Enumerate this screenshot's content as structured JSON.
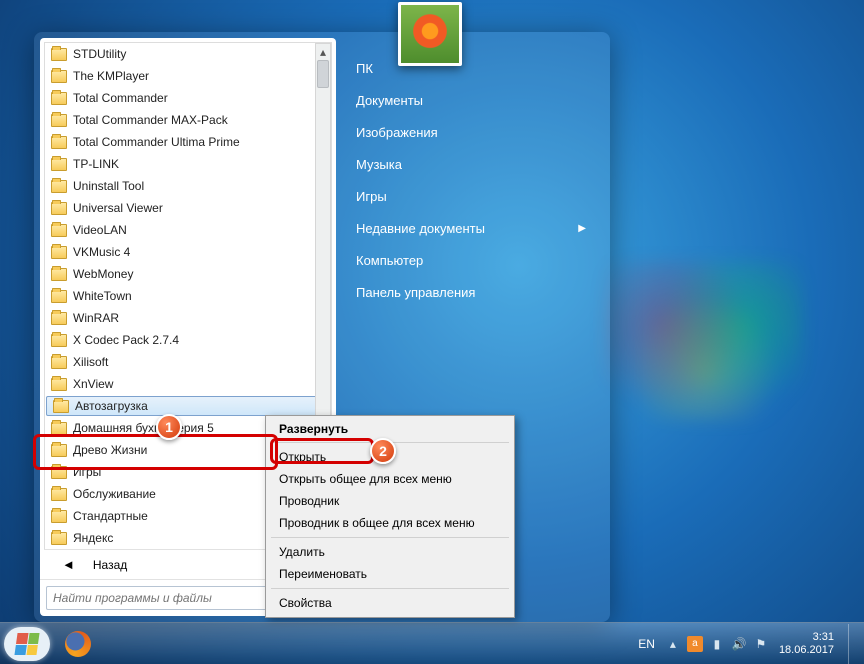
{
  "programs": [
    "STDUtility",
    "The KMPlayer",
    "Total Commander",
    "Total Commander MAX-Pack",
    "Total Commander Ultima Prime",
    "TP-LINK",
    "Uninstall Tool",
    "Universal Viewer",
    "VideoLAN",
    "VKMusic 4",
    "WebMoney",
    "WhiteTown",
    "WinRAR",
    "X Codec Pack 2.7.4",
    "Xilisoft",
    "XnView",
    "Автозагрузка",
    "Домашняя бухгалтерия 5",
    "Древо Жизни",
    "Игры",
    "Обслуживание",
    "Стандартные",
    "Яндекс"
  ],
  "back_label": "Назад",
  "search_placeholder": "Найти программы и файлы",
  "right_links": [
    {
      "label": "ПК",
      "sub": false
    },
    {
      "label": "Документы",
      "sub": false
    },
    {
      "label": "Изображения",
      "sub": false
    },
    {
      "label": "Музыка",
      "sub": false
    },
    {
      "label": "Игры",
      "sub": false
    },
    {
      "label": "Недавние документы",
      "sub": true
    },
    {
      "label": "Компьютер",
      "sub": false
    },
    {
      "label": "Панель управления",
      "sub": false
    }
  ],
  "ctx": {
    "header": "Развернуть",
    "items1": [
      "Открыть",
      "Открыть общее для всех меню",
      "Проводник",
      "Проводник в общее для всех меню"
    ],
    "items2": [
      "Удалить",
      "Переименовать"
    ],
    "items3": [
      "Свойства"
    ]
  },
  "badges": {
    "one": "1",
    "two": "2"
  },
  "taskbar": {
    "lang": "EN",
    "time": "3:31",
    "date": "18.06.2017"
  },
  "highlighted_program_index": 16
}
